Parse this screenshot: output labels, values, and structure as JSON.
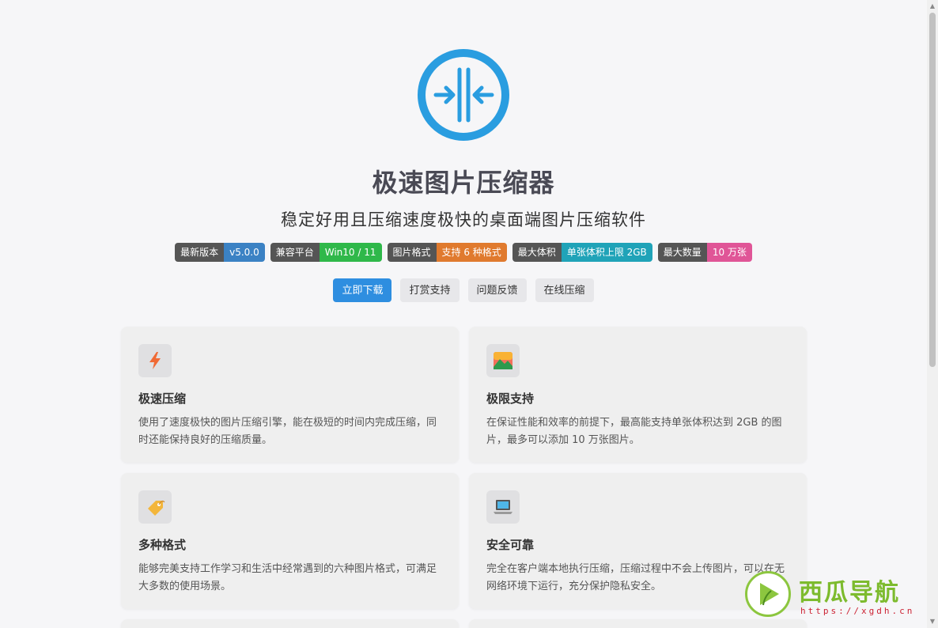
{
  "app": {
    "title": "极速图片压缩器",
    "subtitle": "稳定好用且压缩速度极快的桌面端图片压缩软件"
  },
  "badges": [
    {
      "key": "最新版本",
      "value": "v5.0.0",
      "color": "#3b82c4"
    },
    {
      "key": "兼容平台",
      "value": "Win10 / 11",
      "color": "#2fb84a"
    },
    {
      "key": "图片格式",
      "value": "支持 6 种格式",
      "color": "#e07a2e"
    },
    {
      "key": "最大体积",
      "value": "单张体积上限 2GB",
      "color": "#20a3b8"
    },
    {
      "key": "最大数量",
      "value": "10 万张",
      "color": "#e05597"
    }
  ],
  "buttons": {
    "download": "立即下载",
    "donate": "打赏支持",
    "feedback": "问题反馈",
    "online": "在线压缩"
  },
  "features": [
    {
      "icon": "lightning-icon",
      "title": "极速压缩",
      "desc": "使用了速度极快的图片压缩引擎，能在极短的时间内完成压缩，同时还能保持良好的压缩质量。"
    },
    {
      "icon": "picture-icon",
      "title": "极限支持",
      "desc": "在保证性能和效率的前提下，最高能支持单张体积达到 2GB 的图片，最多可以添加 10 万张图片。"
    },
    {
      "icon": "tag-icon",
      "title": "多种格式",
      "desc": "能够完美支持工作学习和生活中经常遇到的六种图片格式，可满足大多数的使用场景。"
    },
    {
      "icon": "laptop-icon",
      "title": "安全可靠",
      "desc": "完全在客户端本地执行压缩，压缩过程中不会上传图片，可以在无网络环境下运行，充分保护隐私安全。"
    }
  ],
  "watermark": {
    "name": "西瓜导航",
    "url": "https://xgdh.cn"
  },
  "colors": {
    "primary": "#2e8ee0",
    "logo": "#2a9de0"
  }
}
